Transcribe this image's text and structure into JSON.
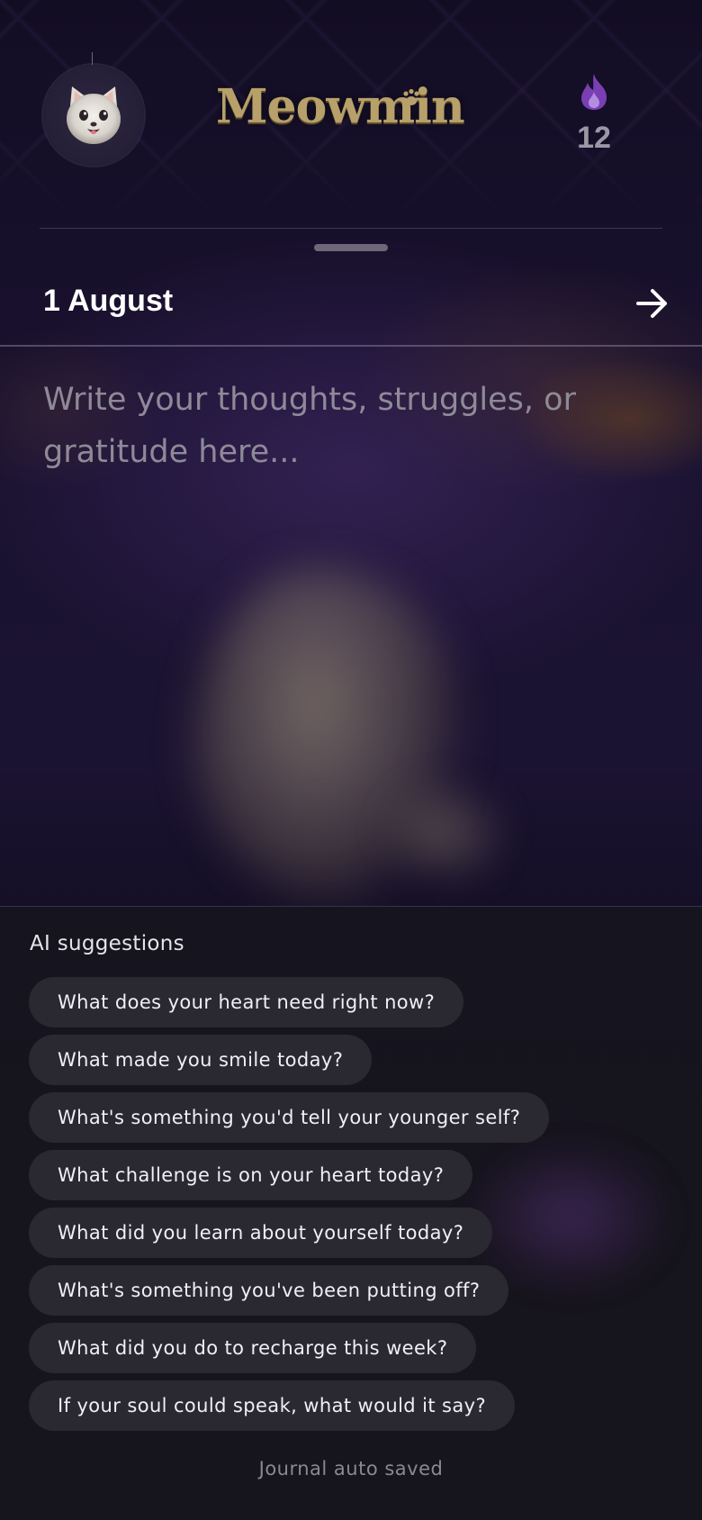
{
  "header": {
    "avatar_icon": "cat-face-icon",
    "logo_text": "Meowmin",
    "logo_icon": "paw-icon",
    "streak_icon": "flame-icon",
    "streak_count": "12",
    "colors": {
      "logo_gold": "#b7a06a",
      "flame_purple": "#7a3fb3",
      "background": "#130d24"
    }
  },
  "journal": {
    "date": "1 August",
    "next_icon": "arrow-right-icon",
    "placeholder": "Write your thoughts, struggles, or gratitude here...",
    "value": ""
  },
  "suggestions": {
    "title": "AI suggestions",
    "items": [
      "What does your heart need right now?",
      "What made you smile today?",
      "What's something you'd tell your younger self?",
      "What challenge is on your heart today?",
      "What did you learn about yourself today?",
      "What's something you've been putting off?",
      "What did you do to recharge this week?",
      "If your soul could speak, what would it say?"
    ]
  },
  "status": {
    "autosave_text": "Journal auto saved"
  }
}
